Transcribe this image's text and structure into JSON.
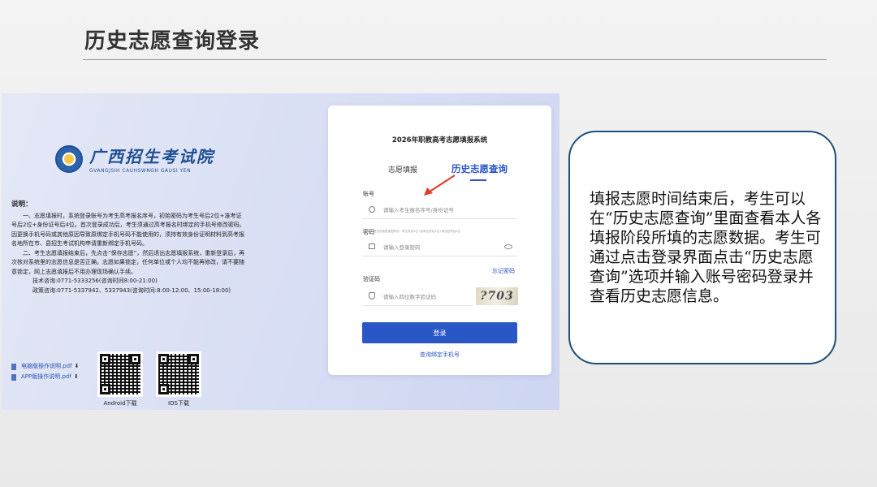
{
  "slide": {
    "title": "历史志愿查询登录"
  },
  "portal": {
    "logo_cn": "广西招生考试院",
    "logo_en": "GVANGJSIH CAUHSWNGH GAUSI YEN",
    "desc_heading": "说明：",
    "desc_paragraphs": [
      "一、志愿填报时，系统登录账号为考生高考报名序号，初始密码为考生号后2位+准考证号后2位+身份证号后4位。首次登录成功后，考生须通过高考报名时绑定的手机号修改密码。因更换手机号码或其他原因导致原绑定手机号码不能使用的，须持有效身份证明材料到高考报名地所在市、县招生考试机构申请重新绑定手机号码。",
      "二、考生志愿填报结束后，先点击“保存志愿”，然后退出志愿填报系统，重新登录后，再次核对系统里的志愿信息是否正确。志愿如果锁定，任何单位或个人均不能再修改，请不要随意锁定，网上志愿填报后不用办理现场确认手续。"
    ],
    "tech_contact": "技术咨询:0771-5333256(咨询时间8:00-21:00)",
    "policy_contact": "政策咨询:0771-5337942、5337943(咨询时间:8:00-12:00、15:00-18:00)",
    "files": [
      {
        "label": "电脑版操作说明.pdf"
      },
      {
        "label": "APP版操作说明.pdf"
      }
    ],
    "download_icon": "⬇",
    "qr_android_caption": "Android下载",
    "qr_ios_caption": "IOS下载"
  },
  "login": {
    "system_title": "2026年职教高考志愿填报系统",
    "tab_fill": "志愿填报",
    "tab_history": "历史志愿查询",
    "account_label": "账号",
    "account_placeholder": "请输入考生报名序号/身份证号",
    "password_label": "密码",
    "password_hint": "考生初始登录密码为：考生号后2位+准考证号后2位+身份证号后4位",
    "password_placeholder": "请输入登录密码",
    "forgot": "忘记密码",
    "captcha_label": "验证码",
    "captcha_placeholder": "请输入四位数字验证码",
    "captcha_value": "?703",
    "submit": "登录",
    "bind_phone_link": "查询绑定手机号"
  },
  "note": {
    "text": "填报志愿时间结束后，考生可以在“历史志愿查询”里面查看本人各填报阶段所填的志愿数据。考生可通过点击登录界面点击“历史志愿查询”选项并输入账号密码登录并查看历史志愿信息。"
  },
  "colors": {
    "accent": "#2a56c6",
    "annotation_arrow": "#e03c2a",
    "note_border": "#1f4e79"
  }
}
